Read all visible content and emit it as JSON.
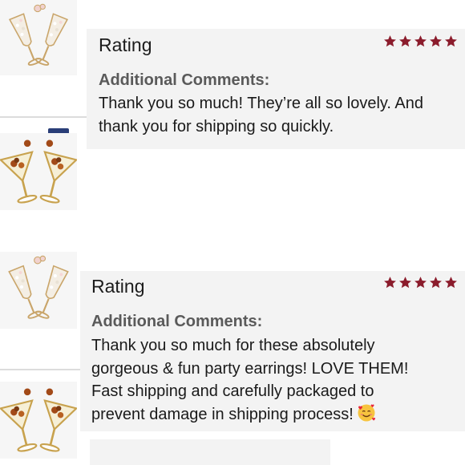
{
  "reviews": [
    {
      "title": "Rating",
      "stars": 5,
      "comments_label": "Additional Comments:",
      "comment_lines": [
        "Thank you so much! They’re all so lovely. And",
        "thank you for shipping so quickly."
      ]
    },
    {
      "title": "Rating",
      "stars": 5,
      "comments_label": "Additional Comments:",
      "comment_lines": [
        "Thank you so much for these absolutely",
        "gorgeous & fun party earrings! LOVE THEM!",
        "Fast shipping and carefully packaged to",
        "prevent damage in shipping process!"
      ],
      "emoji": "smiling-face-with-hearts"
    }
  ],
  "colors": {
    "star": "#8b1c2c",
    "card_bg": "#f3f3f3",
    "label": "#5a5a5a"
  }
}
